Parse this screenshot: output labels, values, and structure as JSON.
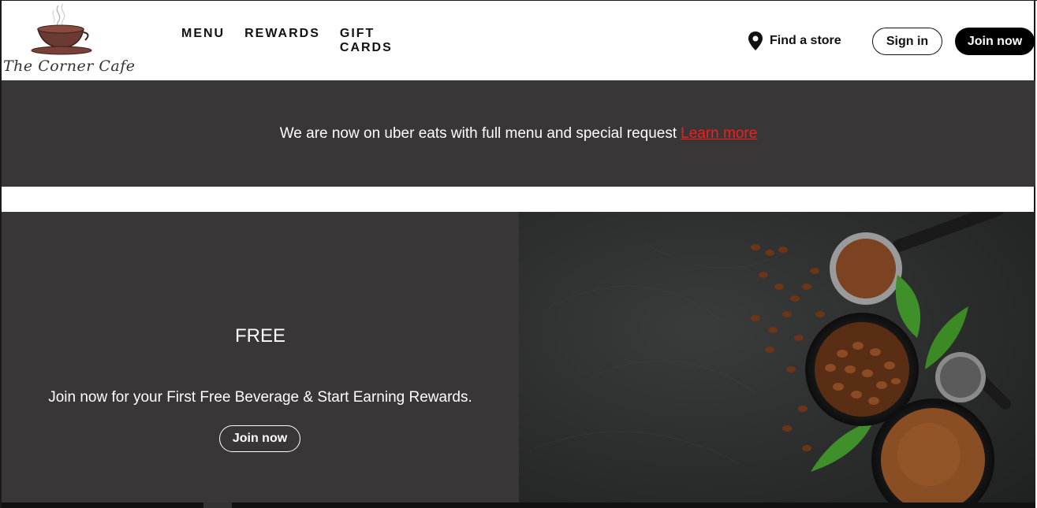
{
  "brand": {
    "name": "The Corner Cafe",
    "logo_icon": "coffee-cup-icon"
  },
  "nav": {
    "items": [
      {
        "label": "MENU"
      },
      {
        "label": "REWARDS"
      },
      {
        "label": "GIFT CARDS"
      }
    ]
  },
  "header_actions": {
    "find_store_label": "Find a store",
    "find_store_icon": "map-pin-icon",
    "signin_label": "Sign in",
    "join_label": "Join now"
  },
  "announcement": {
    "text": "We are now on uber eats with full menu and special request",
    "link_label": "Learn more",
    "link_color": "#ff1a1a"
  },
  "hero": {
    "title": "FREE",
    "subtitle": "Join now for your First Free Beverage & Start Earning Rewards.",
    "button_label": "Join now",
    "image": "coffee-beans-and-ground-coffee-photo"
  },
  "colors": {
    "dark_panel": "#383637",
    "black": "#000000",
    "white": "#ffffff"
  }
}
